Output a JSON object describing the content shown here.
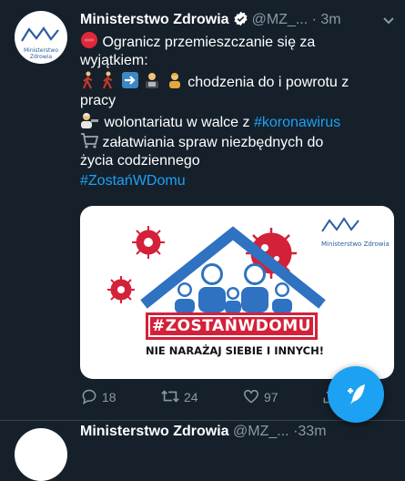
{
  "tweet": {
    "author_name": "Ministerstwo Zdrowia",
    "handle": "@MZ_...",
    "separator": "·",
    "time": "3m",
    "avatar_text": "Ministerstwo Zdrowia",
    "lines": {
      "l1": "Ogranicz przemieszczanie się za",
      "l2": "wyjątkiem:",
      "l3": "chodzenia do i powrotu z",
      "l4": "pracy",
      "l5a": "wolontariatu w walce z ",
      "l5b": "#koronawirus",
      "l6": "załatwiania spraw niezbędnych do",
      "l7": "życia codziennego",
      "l8": "#ZostańWDomu"
    },
    "emojis": [
      "stop-sign",
      "person-walking",
      "person-walking",
      "right-arrow",
      "office-worker",
      "office-worker",
      "volunteer",
      "shopping-cart"
    ]
  },
  "card": {
    "logo_text": "Ministerstwo Zdrowia",
    "banner_title": "#ZOSTAŃWDOMU",
    "banner_subtitle": "NIE NARAŻAJ SIEBIE I INNYCH!"
  },
  "actions": {
    "replies": "18",
    "retweets": "24",
    "likes": "97"
  },
  "next_tweet": {
    "author_name": "Ministerstwo Zdrowia",
    "handle": "@MZ_...",
    "time": "·33m"
  },
  "colors": {
    "background": "#15202b",
    "accent": "#1da1f2",
    "muted": "#8899a6",
    "brand_red": "#d4213a",
    "brand_blue": "#2a5d9f"
  }
}
